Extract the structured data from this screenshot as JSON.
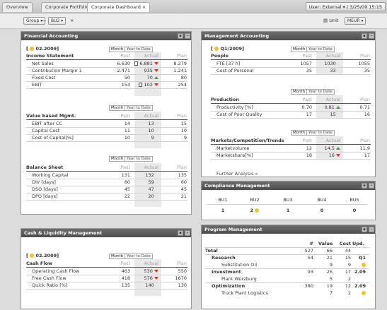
{
  "tabs": [
    "Overview",
    "Corporate Portfolio",
    "Corporate Dashboard"
  ],
  "tab_close": "×",
  "user_label": "User: External",
  "datetime": "3/25/09 15:15",
  "toolbar": {
    "group": "Group",
    "bu": "BU2",
    "close": "×",
    "unit_label": "Unit",
    "unit_value": "MEUR"
  },
  "fa": {
    "title": "Financial Accounting",
    "date": "02.2009",
    "seg_month": "Month",
    "seg_ytd": "Year to Date",
    "col_past": "Past",
    "col_actual": "Actual",
    "col_plan": "Plan",
    "income_title": "Income Statement",
    "income": [
      {
        "label": "Net Sales",
        "past": "6.630",
        "actual": "6.881",
        "plan": "8.279",
        "ind": "down",
        "doc": true
      },
      {
        "label": "Contribution Margin 1",
        "past": "2.471",
        "actual": "935",
        "plan": "1.241",
        "ind": "down",
        "doc": false
      },
      {
        "label": "Fixed Cost",
        "past": "50",
        "actual": "70",
        "plan": "80",
        "ind": "up",
        "doc": false
      },
      {
        "label": "EBIT",
        "past": "154",
        "actual": "102",
        "plan": "254",
        "ind": "down",
        "doc": true
      }
    ],
    "vbm_title": "Value based Mgmt.",
    "vbm": [
      {
        "label": "EBIT after CC",
        "past": "14",
        "actual": "13",
        "plan": "15"
      },
      {
        "label": "Capital Cost",
        "past": "11",
        "actual": "10",
        "plan": "10"
      },
      {
        "label": "Cost of Capital[%]",
        "past": "10",
        "actual": "9",
        "plan": "9"
      }
    ],
    "bs_title": "Balance Sheet",
    "bs": [
      {
        "label": "Working Capital",
        "past": "131",
        "actual": "132",
        "plan": "135"
      },
      {
        "label": "DIV [days]",
        "past": "60",
        "actual": "59",
        "plan": "60"
      },
      {
        "label": "DSO [days]",
        "past": "45",
        "actual": "47",
        "plan": "45"
      },
      {
        "label": "DPO [days]",
        "past": "22",
        "actual": "20",
        "plan": "21"
      }
    ]
  },
  "ma": {
    "title": "Management Accounting",
    "date": "Q1/2009",
    "seg_month": "Month",
    "seg_ytd": "Year to Date",
    "col_past": "Past",
    "col_actual": "Actual",
    "col_plan": "Plan",
    "people_title": "People",
    "people": [
      {
        "label": "FTE [37 h]",
        "past": "1057",
        "actual": "1030",
        "plan": "1055"
      },
      {
        "label": "Cost of Personal",
        "past": "35",
        "actual": "33",
        "plan": "35"
      }
    ],
    "prod_title": "Production",
    "prod": [
      {
        "label": "Productivity [%]",
        "past": "0.70",
        "actual": "0.81",
        "plan": "0.71",
        "ind": "up"
      },
      {
        "label": "Cost of Poor Quality",
        "past": "17",
        "actual": "15",
        "plan": "16",
        "ind": ""
      }
    ],
    "mkt_title": "Markets/Competition/Trends",
    "mkt": [
      {
        "label": "Marketvolume",
        "past": "12",
        "actual": "14,5",
        "plan": "11,9",
        "ind": "up"
      },
      {
        "label": "Marketshare[%]",
        "past": "18",
        "actual": "16",
        "plan": "17",
        "ind": "down"
      }
    ],
    "further": "Further Analysis »"
  },
  "cm": {
    "title": "Compliance Management",
    "headers": [
      "BU1",
      "BU2",
      "BU3",
      "BU4",
      "BU5"
    ],
    "values": [
      "1",
      "2",
      "1",
      "0",
      "0"
    ]
  },
  "cl": {
    "title": "Cash & Liquidity Management",
    "date": "02.2009",
    "seg_month": "Month",
    "seg_ytd": "Year to Date",
    "col_past": "Past",
    "col_actual": "Actual",
    "col_plan": "Plan",
    "cf_title": "Cash Flow",
    "cf": [
      {
        "label": "Operating Cash Flow",
        "past": "463",
        "actual": "530",
        "plan": "550",
        "ind": "down"
      },
      {
        "label": "Free Cash Flow",
        "past": "418",
        "actual": "576",
        "plan": "1670",
        "ind": "down"
      },
      {
        "label": "Quick Ratio [%]",
        "past": "135",
        "actual": "140",
        "plan": "130",
        "ind": ""
      }
    ]
  },
  "pm": {
    "title": "Program Management",
    "headers": [
      "#",
      "Value",
      "Cost",
      "Upd."
    ],
    "rows": [
      {
        "label": "Total",
        "n": "527",
        "value": "66",
        "cost": "44",
        "upd": "",
        "level": 0
      },
      {
        "label": "Research",
        "n": "54",
        "value": "21",
        "cost": "15",
        "upd": "Q1",
        "level": 1
      },
      {
        "label": "Substitution Oil",
        "n": "",
        "value": "9",
        "cost": "9",
        "upd": "dot",
        "level": 2
      },
      {
        "label": "Investment",
        "n": "93",
        "value": "26",
        "cost": "17",
        "upd": "2.09",
        "level": 1
      },
      {
        "label": "Plant Würzburg",
        "n": "",
        "value": "5",
        "cost": "2",
        "upd": "",
        "level": 2
      },
      {
        "label": "Optimization",
        "n": "380",
        "value": "19",
        "cost": "12",
        "upd": "2.09",
        "level": 1
      },
      {
        "label": "Truck Plant Logistics",
        "n": "",
        "value": "7",
        "cost": "2",
        "upd": "dot",
        "level": 2
      }
    ]
  }
}
